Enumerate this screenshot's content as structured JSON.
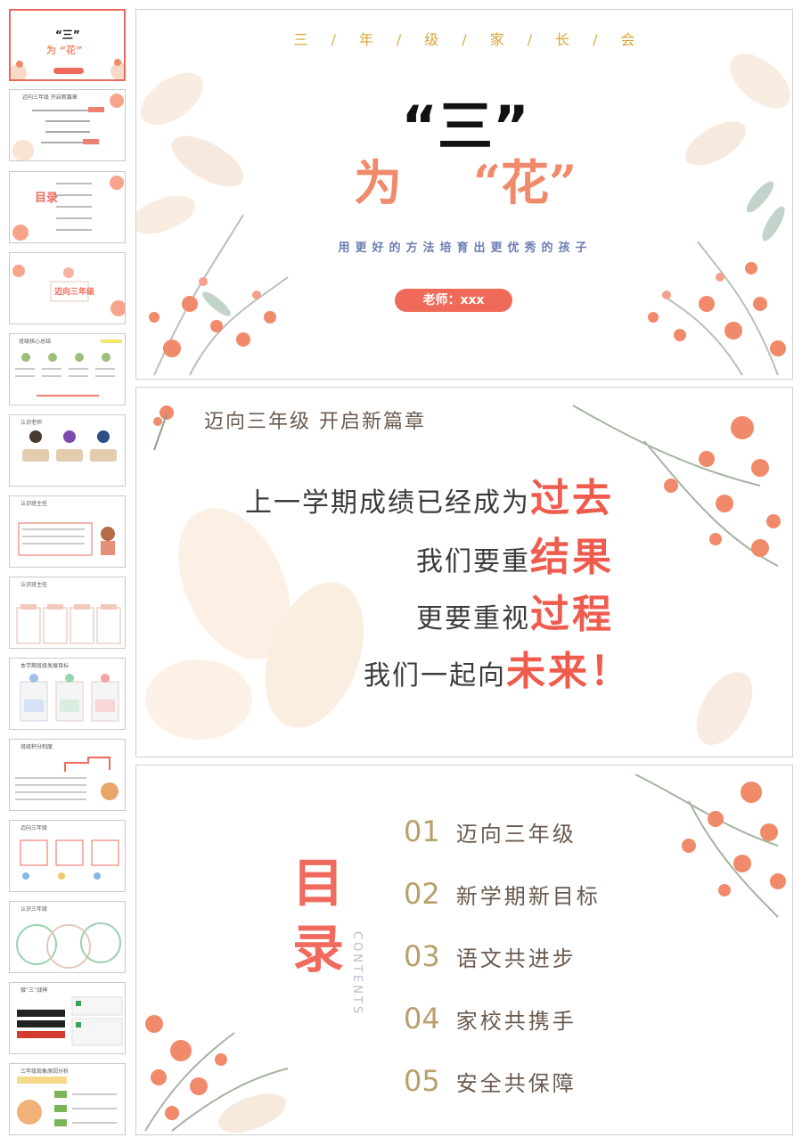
{
  "colors": {
    "accent": "#ef6a58",
    "gold": "#d9a53a",
    "brown": "#6b5a4e",
    "blue": "#6b7db3"
  },
  "sidebar": {
    "thumbs": [
      {
        "label": "“三”",
        "sub": "为 “花”",
        "active": true
      },
      {
        "label": "迈向三年级 开启新篇章"
      },
      {
        "label": "目录"
      },
      {
        "label": "迈向三年级"
      },
      {
        "label": "班级核心总结"
      },
      {
        "label": "认识老师"
      },
      {
        "label": "认识班主任"
      },
      {
        "label": "认识班主任"
      },
      {
        "label": "本学期班级发展目标"
      },
      {
        "label": "班级积分制度"
      },
      {
        "label": "迈向三年级"
      },
      {
        "label": "认识三年级"
      },
      {
        "label": "做“三”战神"
      },
      {
        "label": "三年级现象原因分析"
      }
    ]
  },
  "slide1": {
    "top_letters": [
      "三",
      "/",
      "年",
      "/",
      "级",
      "/",
      "家",
      "/",
      "长",
      "/",
      "会"
    ],
    "quote": "“三”",
    "flower_left": "为",
    "flower_right": "“花”",
    "subtitle": "用更好的方法培育出更优秀的孩子",
    "teacher": "老师：xxx"
  },
  "slide2": {
    "title": "迈向三年级 开启新篇章",
    "lines": [
      {
        "text": "上一学期成绩已经成为",
        "emph": "过去"
      },
      {
        "text": "我们要重",
        "emph": "结果"
      },
      {
        "text": "更要重视",
        "emph": "过程"
      },
      {
        "text": "我们一起向",
        "emph": "未来！"
      }
    ]
  },
  "slide3": {
    "mu": "目",
    "lu": "录",
    "contents": "CONTENTS",
    "items": [
      {
        "num": "01",
        "label": "迈向三年级"
      },
      {
        "num": "02",
        "label": "新学期新目标"
      },
      {
        "num": "03",
        "label": "语文共进步"
      },
      {
        "num": "04",
        "label": "家校共携手"
      },
      {
        "num": "05",
        "label": "安全共保障"
      }
    ]
  }
}
